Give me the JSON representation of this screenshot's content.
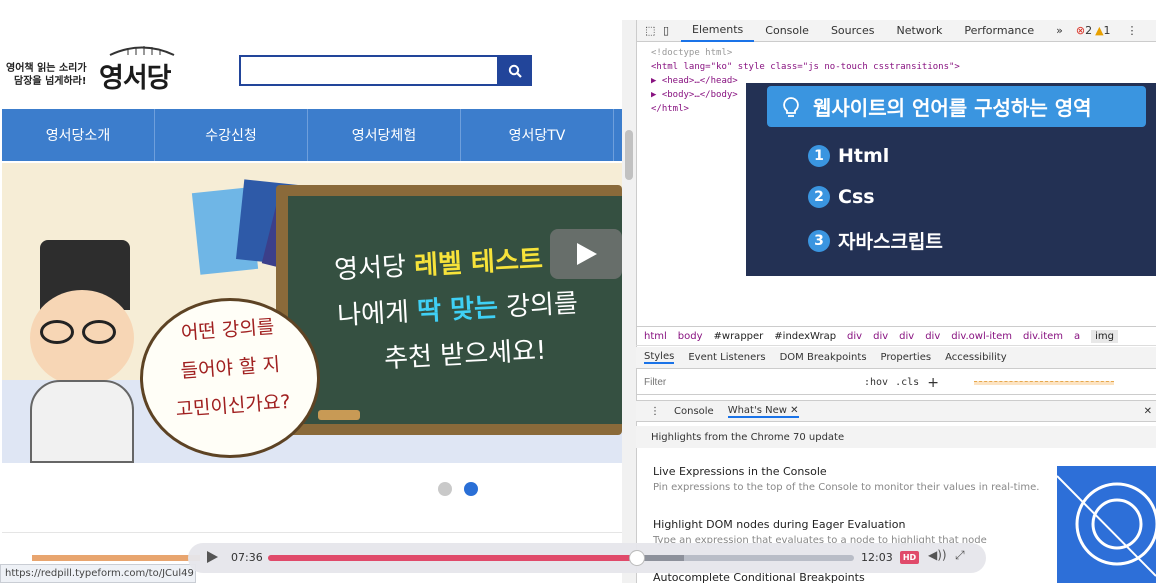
{
  "site": {
    "logo_tagline_1": "영어책 읽는 소리가",
    "logo_tagline_2": "담장을 넘게하라!",
    "logo_name": "영서당",
    "search_placeholder": "",
    "nav": [
      "영서당소개",
      "수강신청",
      "영서당체험",
      "영서당TV"
    ],
    "banner": {
      "line1_prefix": "영서당 ",
      "line1_highlight": "레벨 테스트",
      "line2_prefix": "나에게 ",
      "line2_highlight": "딱 맞는",
      "line2_suffix": " 강의를",
      "line3": "추천 받으세요!",
      "bubble_1": "어떤 강의를",
      "bubble_2": "들어야 할 지",
      "bubble_3": "고민이신가요?"
    },
    "carousel_dots": 2,
    "carousel_active": 2
  },
  "status_url": "https://redpill.typeform.com/to/JCul49",
  "devtools": {
    "tabs": [
      "Elements",
      "Console",
      "Sources",
      "Network",
      "Performance",
      "»"
    ],
    "active_tab": "Elements",
    "errors": "2",
    "warnings": "1",
    "code_lines": [
      "<!doctype html>",
      "<html lang=\"ko\" style class=\"js no-touch csstransitions\">",
      "▶ <head>…</head>",
      "▶ <body>…</body>",
      "</html>"
    ],
    "breadcrumbs": [
      "html",
      "body",
      "#wrapper",
      "#indexWrap",
      "div",
      "div",
      "div",
      "div",
      "div.owl-item",
      "div.item",
      "a",
      "img"
    ],
    "subtabs": [
      "Styles",
      "Event Listeners",
      "DOM Breakpoints",
      "Properties",
      "Accessibility"
    ],
    "filter_placeholder": "Filter",
    "filter_hov": ":hov",
    "filter_cls": ".cls",
    "filter_plus": "+",
    "drawer_tabs": [
      "Console",
      "What's New"
    ],
    "whats_new_header": "Highlights from the Chrome 70 update",
    "items": [
      {
        "title": "Live Expressions in the Console",
        "desc": "Pin expressions to the top of the Console to monitor their values in real-time."
      },
      {
        "title": "Highlight DOM nodes during Eager Evaluation",
        "desc": "Type an expression that evaluates to a node to highlight that node"
      },
      {
        "title": "Autocomplete Conditional Breakpoints",
        "desc": ""
      }
    ]
  },
  "overlay": {
    "title": "웹사이트의 언어를 구성하는 영역",
    "items": [
      {
        "num": "1",
        "label": "Html"
      },
      {
        "num": "2",
        "label": "Css"
      },
      {
        "num": "3",
        "label": "자바스크립트"
      }
    ]
  },
  "video": {
    "current_time": "07:36",
    "duration": "12:03",
    "progress": 0.63,
    "quality": "HD"
  },
  "colors": {
    "brand_blue": "#22459a",
    "nav_blue": "#3c7dcc",
    "overlay_bg": "#233154",
    "accent_pink": "#e04a6a"
  }
}
